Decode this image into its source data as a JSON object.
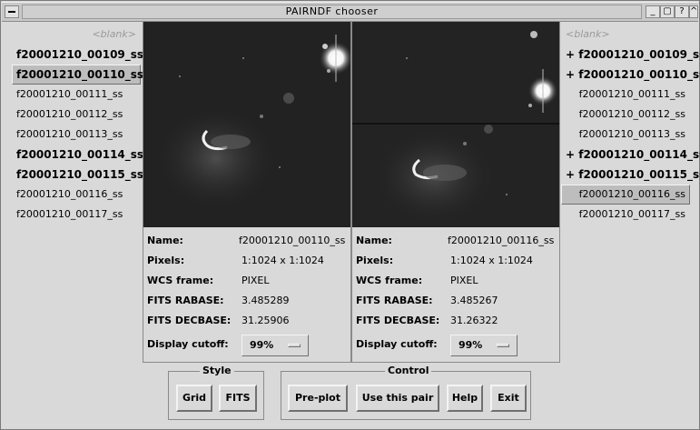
{
  "window": {
    "title": "PAIRNDF chooser",
    "buttons": [
      "_",
      "▢",
      "?",
      "^"
    ]
  },
  "left_list": [
    {
      "label": "<blank>",
      "style": "blank"
    },
    {
      "label": "f20001210_00109_ss +",
      "style": "bold"
    },
    {
      "label": "f20001210_00110_ss +",
      "style": "bold",
      "selected": true
    },
    {
      "label": "f20001210_00111_ss",
      "style": "normal"
    },
    {
      "label": "f20001210_00112_ss",
      "style": "normal"
    },
    {
      "label": "f20001210_00113_ss",
      "style": "normal"
    },
    {
      "label": "f20001210_00114_ss +",
      "style": "bold"
    },
    {
      "label": "f20001210_00115_ss +",
      "style": "bold"
    },
    {
      "label": "f20001210_00116_ss",
      "style": "normal"
    },
    {
      "label": "f20001210_00117_ss",
      "style": "normal"
    }
  ],
  "right_list": [
    {
      "label": "<blank>",
      "style": "blank"
    },
    {
      "label": "+ f20001210_00109_ss",
      "style": "bold"
    },
    {
      "label": "+ f20001210_00110_ss",
      "style": "bold"
    },
    {
      "label": "f20001210_00111_ss",
      "style": "normal"
    },
    {
      "label": "f20001210_00112_ss",
      "style": "normal"
    },
    {
      "label": "f20001210_00113_ss",
      "style": "normal"
    },
    {
      "label": "+ f20001210_00114_ss",
      "style": "bold"
    },
    {
      "label": "+ f20001210_00115_ss",
      "style": "bold"
    },
    {
      "label": "f20001210_00116_ss",
      "style": "normal",
      "selected": true
    },
    {
      "label": "f20001210_00117_ss",
      "style": "normal"
    }
  ],
  "labels": {
    "name": "Name:",
    "pixels": "Pixels:",
    "wcs": "WCS frame:",
    "rabase": "FITS RABASE:",
    "decbase": "FITS DECBASE:",
    "cutoff": "Display cutoff:"
  },
  "left_panel": {
    "name": "f20001210_00110_ss",
    "pixels": "1:1024 x 1:1024",
    "wcs": "PIXEL",
    "rabase": "3.485289",
    "decbase": "31.25906",
    "cutoff": "99%"
  },
  "right_panel": {
    "name": "f20001210_00116_ss",
    "pixels": "1:1024 x 1:1024",
    "wcs": "PIXEL",
    "rabase": "3.485267",
    "decbase": "31.26322",
    "cutoff": "99%"
  },
  "style_group": {
    "title": "Style",
    "grid": "Grid",
    "fits": "FITS"
  },
  "control_group": {
    "title": "Control",
    "preplot": "Pre-plot",
    "use_pair": "Use this pair",
    "help": "Help",
    "exit": "Exit"
  }
}
